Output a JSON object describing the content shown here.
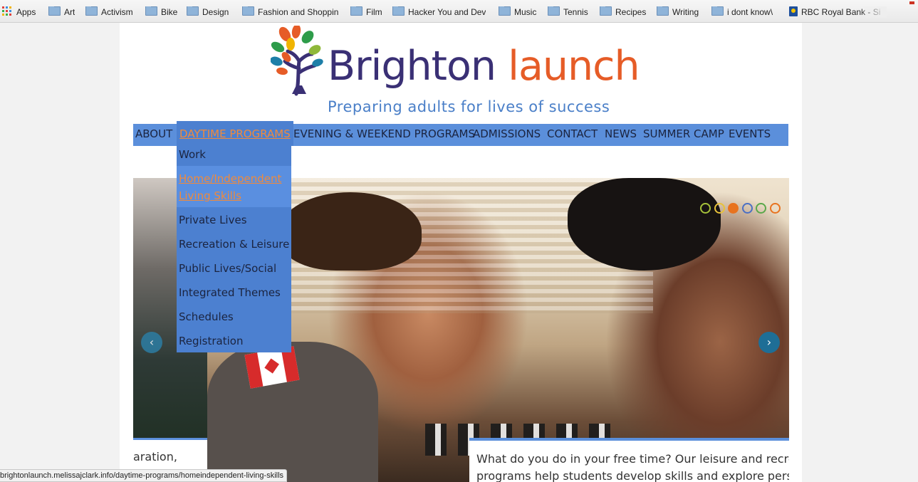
{
  "bookmarks": [
    {
      "label": "Apps",
      "type": "apps"
    },
    {
      "label": "Art",
      "type": "folder"
    },
    {
      "label": "Activism",
      "type": "folder"
    },
    {
      "label": "Bike",
      "type": "folder"
    },
    {
      "label": "Design",
      "type": "folder"
    },
    {
      "label": "Fashion and Shoppin",
      "type": "folder"
    },
    {
      "label": "Film",
      "type": "folder"
    },
    {
      "label": "Hacker You and Dev",
      "type": "folder"
    },
    {
      "label": "Music",
      "type": "folder"
    },
    {
      "label": "Tennis",
      "type": "folder"
    },
    {
      "label": "Recipes",
      "type": "folder"
    },
    {
      "label": "Writing",
      "type": "folder"
    },
    {
      "label": "i dont know\\",
      "type": "folder"
    },
    {
      "label": "RBC Royal Bank - Si",
      "type": "site",
      "icon": "rbc-icon"
    }
  ],
  "site": {
    "brand_part1": "Brighton",
    "brand_part2": "launch",
    "tagline": "Preparing adults for lives of success",
    "logo_icon": "tree-logo-icon"
  },
  "nav": {
    "items": [
      {
        "label": "ABOUT"
      },
      {
        "label": "DAYTIME PROGRAMS",
        "active": true
      },
      {
        "label": "EVENING & WEEKEND PROGRAMS"
      },
      {
        "label": "ADMISSIONS"
      },
      {
        "label": "CONTACT"
      },
      {
        "label": "NEWS"
      },
      {
        "label": "SUMMER CAMP"
      },
      {
        "label": "EVENTS"
      }
    ]
  },
  "dropdown": {
    "items": [
      {
        "label": "Work"
      },
      {
        "label": "Home/Independent",
        "label2": "Living Skills",
        "active": true
      },
      {
        "label": "Private Lives"
      },
      {
        "label": "Recreation & Leisure"
      },
      {
        "label": "Public Lives/Social"
      },
      {
        "label": "Integrated Themes"
      },
      {
        "label": "Schedules"
      },
      {
        "label": "Registration"
      }
    ]
  },
  "slider": {
    "dots": [
      "#a6c23a",
      "#e8c23a",
      "#e8731f",
      "#4a6fc4",
      "#5aa84a",
      "#e8731f"
    ],
    "active_dot": 2,
    "prev_icon": "chevron-left-icon",
    "next_icon": "chevron-right-icon",
    "caption_left": "aration,",
    "caption_right_line1": "What do you do in your free time? Our leisure and recreat",
    "caption_right_line2": "programs help students develop skills and explore person"
  },
  "status_url": "brightonlaunch.melissajclark.info/daytime-programs/homeindependent-living-skills",
  "colors": {
    "nav_bg": "#5b8fdb",
    "dropdown_bg": "#4c80d0",
    "active_link": "#f08a3c",
    "brand_dark": "#3a3075",
    "brand_orange": "#e65c27",
    "tagline": "#4a7fc8"
  }
}
